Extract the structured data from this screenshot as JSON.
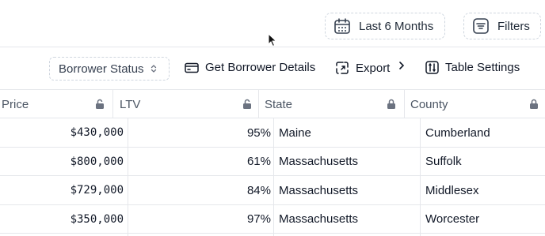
{
  "header": {
    "date_range_label": "Last 6 Months",
    "filters_label": "Filters"
  },
  "toolbar": {
    "borrower_status_label": "Borrower Status",
    "get_details_label": "Get Borrower Details",
    "export_label": "Export",
    "table_settings_label": "Table Settings"
  },
  "table": {
    "columns": [
      "Price",
      "LTV",
      "State",
      "County"
    ],
    "rows": [
      {
        "price": "$430,000",
        "ltv": "95%",
        "state": "Maine",
        "county": "Cumberland"
      },
      {
        "price": "$800,000",
        "ltv": "61%",
        "state": "Massachusetts",
        "county": "Suffolk"
      },
      {
        "price": "$729,000",
        "ltv": "84%",
        "state": "Massachusetts",
        "county": "Middlesex"
      },
      {
        "price": "$350,000",
        "ltv": "97%",
        "state": "Massachusetts",
        "county": "Worcester"
      }
    ]
  },
  "icons": {
    "calendar": "calendar-icon",
    "filter": "filter-lines-icon",
    "select": "chevron-up-down-icon",
    "card": "credit-card-icon",
    "export": "export-icon",
    "arrow": "chevron-right-icon",
    "settings": "table-settings-icon",
    "lock_open": "unlocked-icon",
    "lock_closed": "lock-icon"
  }
}
